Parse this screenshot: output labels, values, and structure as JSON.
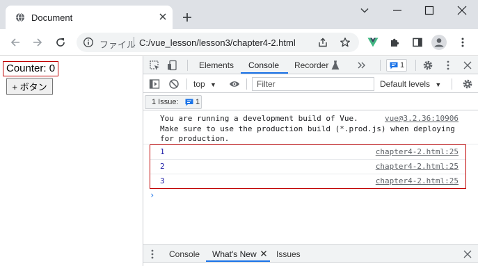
{
  "tab": {
    "title": "Document"
  },
  "toolbar": {
    "scheme_label": "ファイル",
    "url": "C:/vue_lesson/lesson3/chapter4-2.html"
  },
  "page": {
    "counter_label": "Counter:",
    "counter_value": "0",
    "button_label": "+ ボタン"
  },
  "devtools": {
    "tabs": [
      "Elements",
      "Console",
      "Recorder"
    ],
    "active_tab": "Console",
    "issue_count": "1",
    "context": "top",
    "filter_placeholder": "Filter",
    "levels": "Default levels",
    "issues_label": "1 Issue:",
    "issues_count": "1",
    "vue_message": "You are running a development build of Vue.\nMake sure to use the production build (*.prod.js) when deploying\nfor production.",
    "vue_source": "vue@3.2.36:10906",
    "logs": [
      {
        "value": "1",
        "source": "chapter4-2.html:25"
      },
      {
        "value": "2",
        "source": "chapter4-2.html:25"
      },
      {
        "value": "3",
        "source": "chapter4-2.html:25"
      }
    ],
    "drawer_tabs": [
      "Console",
      "What's New",
      "Issues"
    ]
  },
  "colors": {
    "highlight_border": "#c00000",
    "accent": "#1a73e8",
    "vue_green": "#42b883"
  },
  "icons": {
    "favicon": "globe-icon",
    "back": "arrow-left-icon",
    "forward": "arrow-right-icon",
    "reload": "reload-icon",
    "info": "info-icon",
    "share": "share-icon",
    "star": "star-icon",
    "vue_devtools": "vue-logo-icon",
    "extensions": "puzzle-icon",
    "side_panel": "side-panel-icon",
    "profile": "profile-icon",
    "menu": "kebab-menu-icon"
  }
}
